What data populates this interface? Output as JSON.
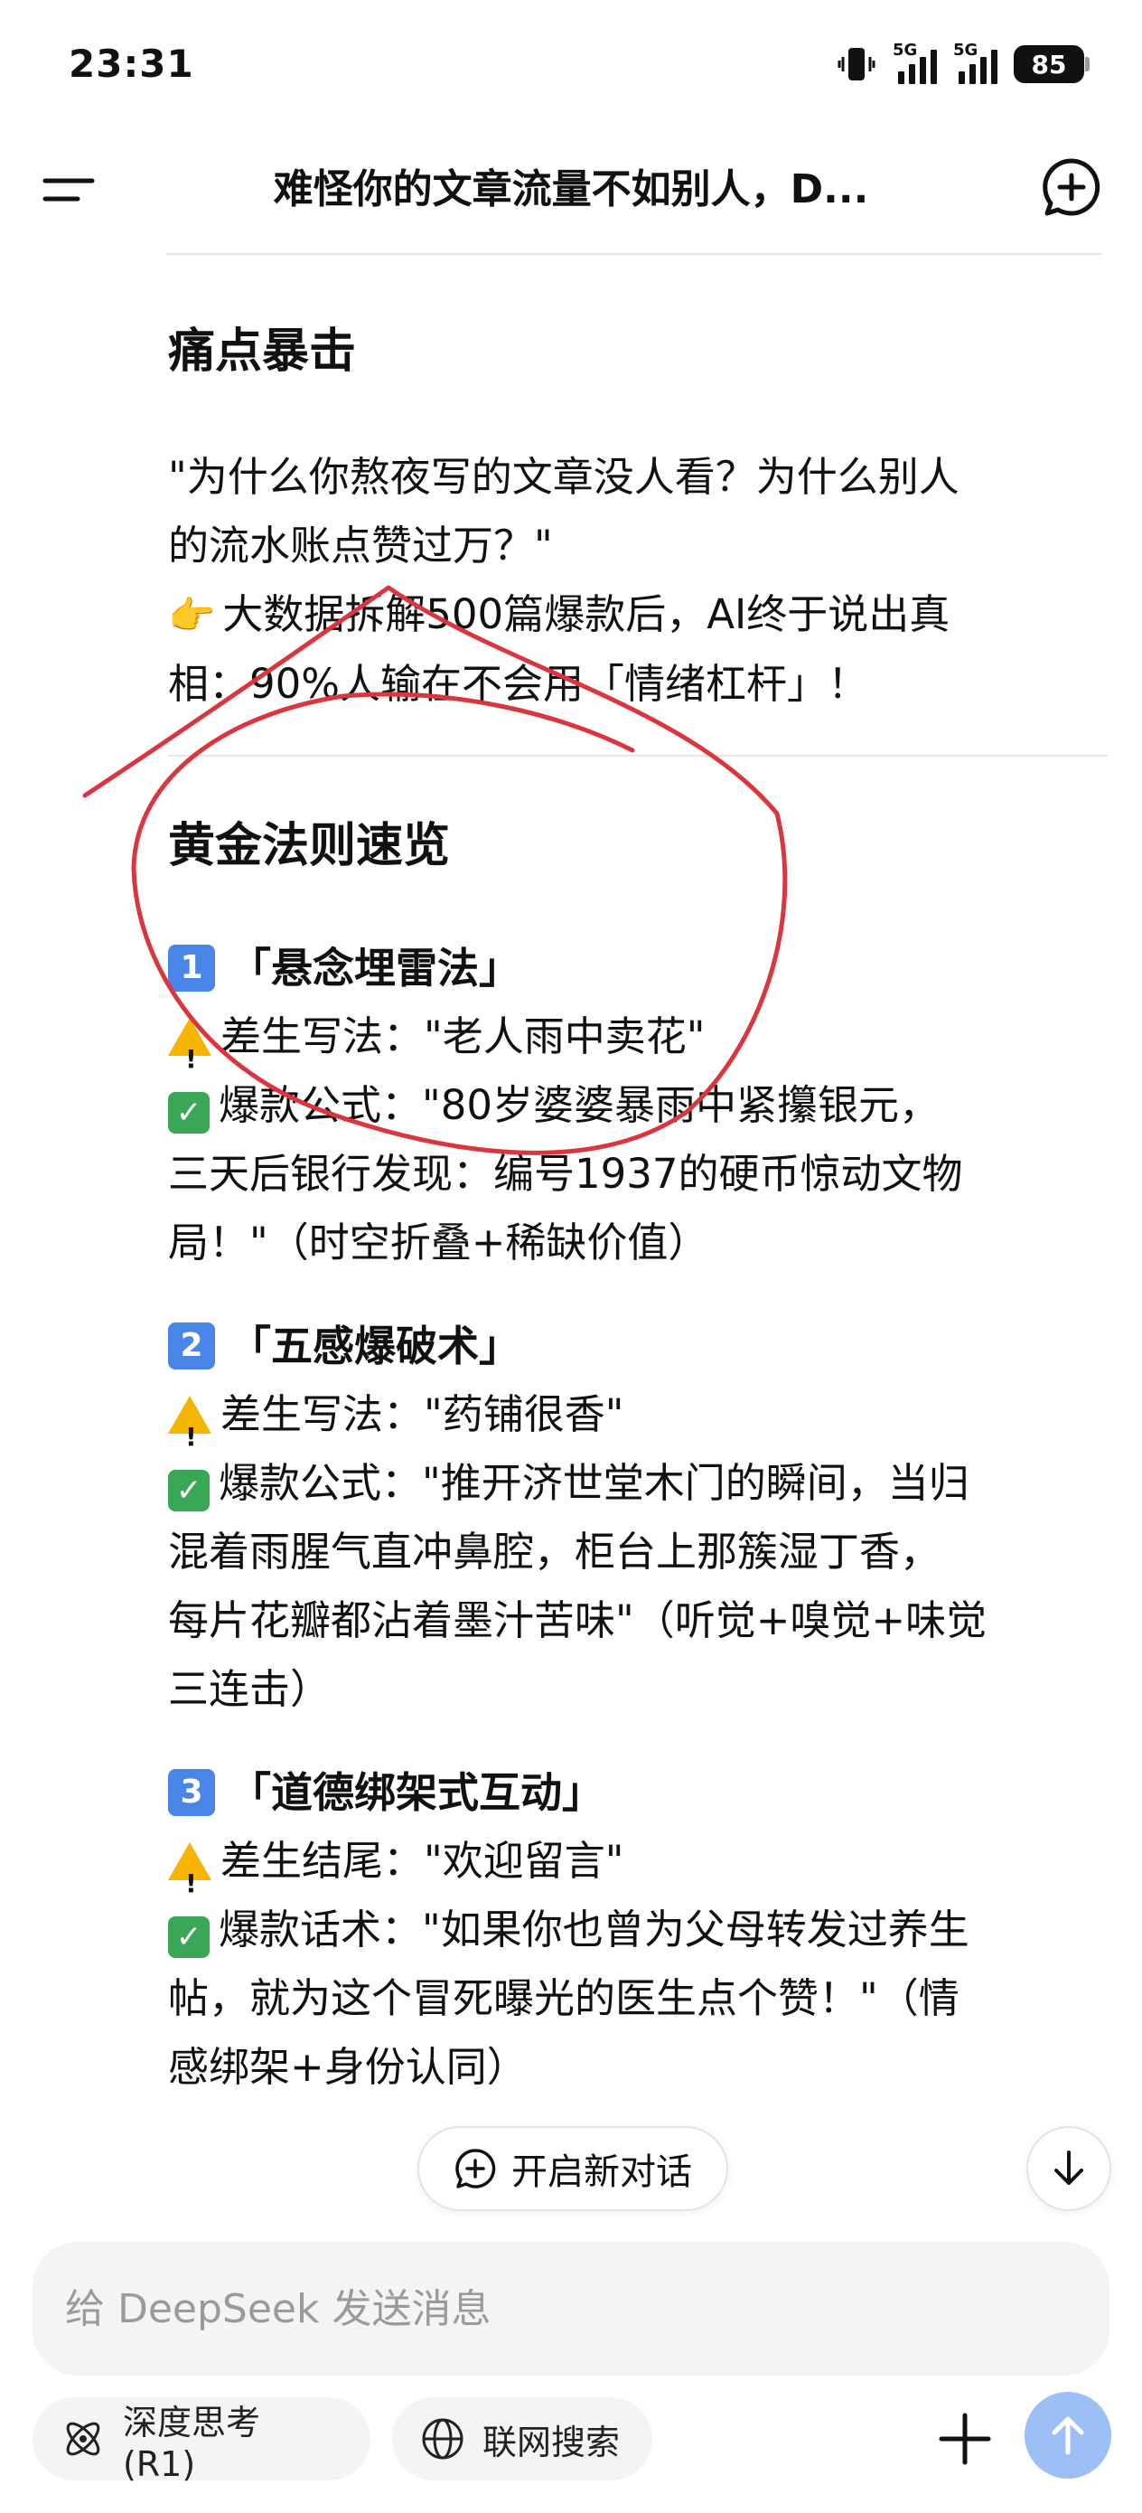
{
  "status_bar": {
    "time": "23:31",
    "signal1_label": "5G",
    "signal2_label": "5G",
    "battery": "85"
  },
  "header": {
    "title": "难怪你的文章流量不如别人，D...",
    "menu_icon": "menu-icon",
    "new_chat_icon": "new-chat-icon"
  },
  "content": {
    "section1": {
      "title": "痛点暴击",
      "lines": [
        "\"为什么你熬夜写的文章没人看？为什么别人",
        "的流水账点赞过万？\"",
        "大数据拆解500篇爆款后，AI终于说出真",
        "相：90%人输在不会用「情绪杠杆」！"
      ],
      "point_emoji": "👉"
    },
    "section2": {
      "title": "黄金法则速览",
      "items": [
        {
          "num": "1",
          "title": "「悬念埋雷法」",
          "bad": "差生写法：\"老人雨中卖花\"",
          "good_lines": [
            "爆款公式：\"80岁婆婆暴雨中紧攥银元，",
            "三天后银行发现：编号1937的硬币惊动文物",
            "局！\"（时空折叠+稀缺价值）"
          ]
        },
        {
          "num": "2",
          "title": "「五感爆破术」",
          "bad": "差生写法：\"药铺很香\"",
          "good_lines": [
            "爆款公式：\"推开济世堂木门的瞬间，当归",
            "混着雨腥气直冲鼻腔，柜台上那簇湿丁香，",
            "每片花瓣都沾着墨汁苦味\"（听觉+嗅觉+味觉",
            "三连击）"
          ]
        },
        {
          "num": "3",
          "title": "「道德绑架式互动」",
          "bad": "差生结尾：\"欢迎留言\"",
          "good_lines": [
            "爆款话术：\"如果你也曾为父母转发过养生",
            "帖，就为这个冒死曝光的医生点个赞！\"（情",
            "感绑架+身份认同）"
          ]
        }
      ]
    }
  },
  "floating": {
    "new_chat_label": "开启新对话"
  },
  "input": {
    "placeholder": "给 DeepSeek 发送消息"
  },
  "toolbar": {
    "deep_think_label": "深度思考 (R1)",
    "web_search_label": "联网搜索"
  },
  "colors": {
    "send_button": "#9cbff5",
    "annotation": "#d9363e",
    "badge": "#4a86e8"
  }
}
